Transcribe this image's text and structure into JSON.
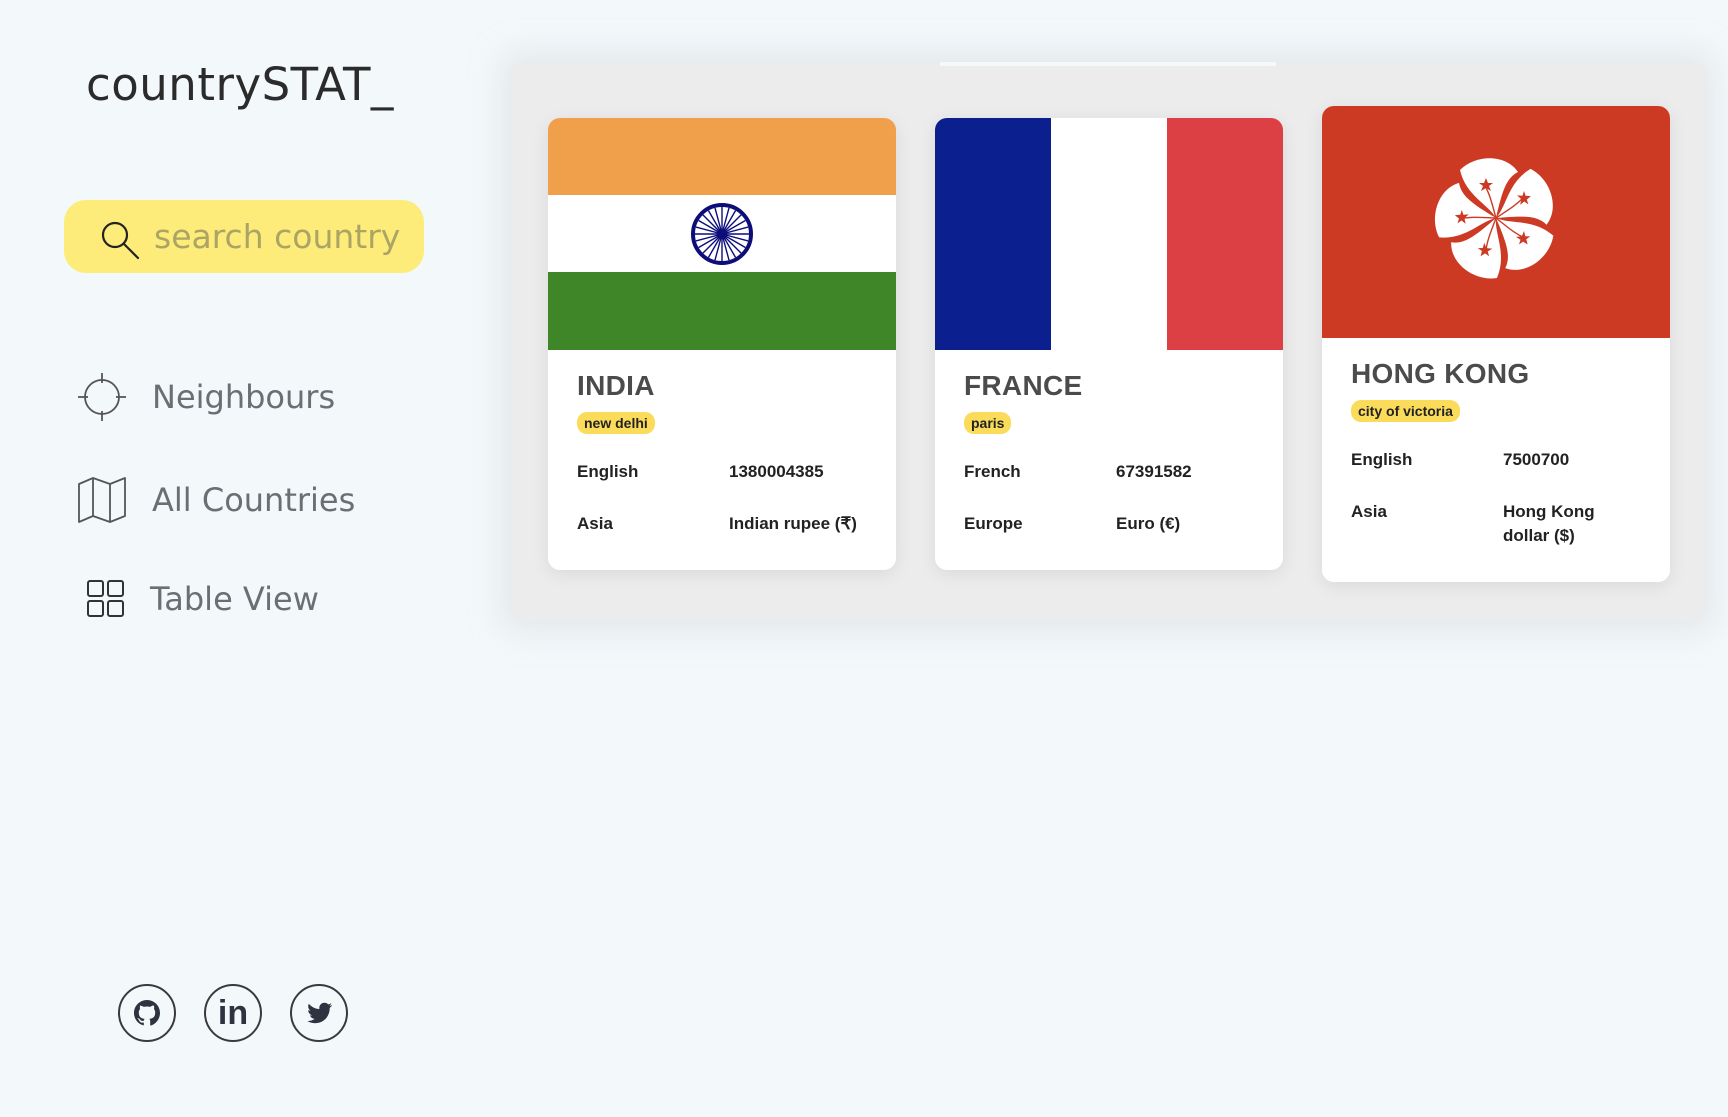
{
  "app": {
    "logo": "countrySTAT_"
  },
  "search": {
    "placeholder": "search country",
    "icon": "search-icon"
  },
  "nav": [
    {
      "label": "Neighbours",
      "icon": "crosshair-icon"
    },
    {
      "label": "All Countries",
      "icon": "map-icon"
    },
    {
      "label": "Table View",
      "icon": "grid-icon"
    }
  ],
  "socials": [
    {
      "name": "github",
      "icon": "github-icon"
    },
    {
      "name": "linkedin",
      "icon": "linkedin-icon",
      "text": "in"
    },
    {
      "name": "twitter",
      "icon": "twitter-icon"
    }
  ],
  "cards": [
    {
      "name": "INDIA",
      "capital": "new delhi",
      "language": "English",
      "population": "1380004385",
      "region": "Asia",
      "currency": "Indian rupee (₹)",
      "flag": "india-flag",
      "colors": {
        "saffron": "#f09f4a",
        "white": "#ffffff",
        "green": "#3f8628",
        "chakra": "#0d0d7a"
      }
    },
    {
      "name": "FRANCE",
      "capital": "paris",
      "language": "French",
      "population": "67391582",
      "region": "Europe",
      "currency": "Euro (€)",
      "flag": "france-flag",
      "colors": {
        "blue": "#0c1f8f",
        "white": "#ffffff",
        "red": "#dc4045"
      }
    },
    {
      "name": "HONG KONG",
      "capital": "city of victoria",
      "language": "English",
      "population": "7500700",
      "region": "Asia",
      "currency": "Hong Kong dollar ($)",
      "flag": "hong-kong-flag",
      "colors": {
        "red": "#cd3a24",
        "white": "#ffffff"
      }
    }
  ],
  "theme": {
    "background": "#f3f8fb",
    "accent": "#fdec7a",
    "badge": "#fbdb5a"
  }
}
